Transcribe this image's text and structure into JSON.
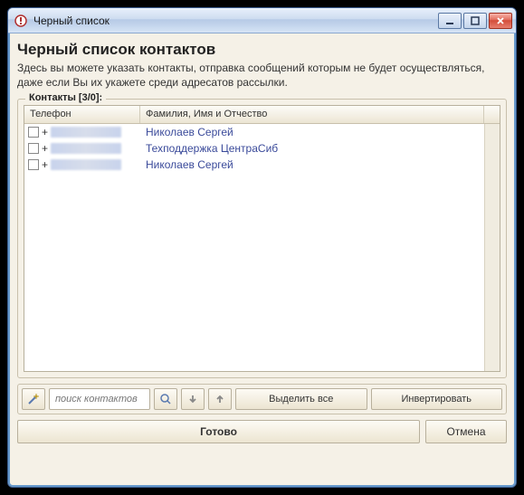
{
  "window": {
    "title": "Черный список"
  },
  "header": {
    "title": "Черный список контактов",
    "description": "Здесь вы можете указать контакты, отправка сообщений которым не будет осуществляться, даже если Вы их укажете среди адресатов рассылки."
  },
  "contacts": {
    "legend": "Контакты [3/0]:",
    "columns": {
      "phone": "Телефон",
      "name": "Фамилия, Имя и Отчество"
    },
    "rows": [
      {
        "phone_prefix": "+",
        "name": "Николаев Сергей",
        "checked": false
      },
      {
        "phone_prefix": "+",
        "name": "Техподдержка ЦентраСиб",
        "checked": false
      },
      {
        "phone_prefix": "+",
        "name": "Николаев Сергей",
        "checked": false
      }
    ]
  },
  "toolbar": {
    "search_placeholder": "поиск контактов",
    "select_all": "Выделить все",
    "invert": "Инвертировать"
  },
  "footer": {
    "done": "Готово",
    "cancel": "Отмена"
  }
}
